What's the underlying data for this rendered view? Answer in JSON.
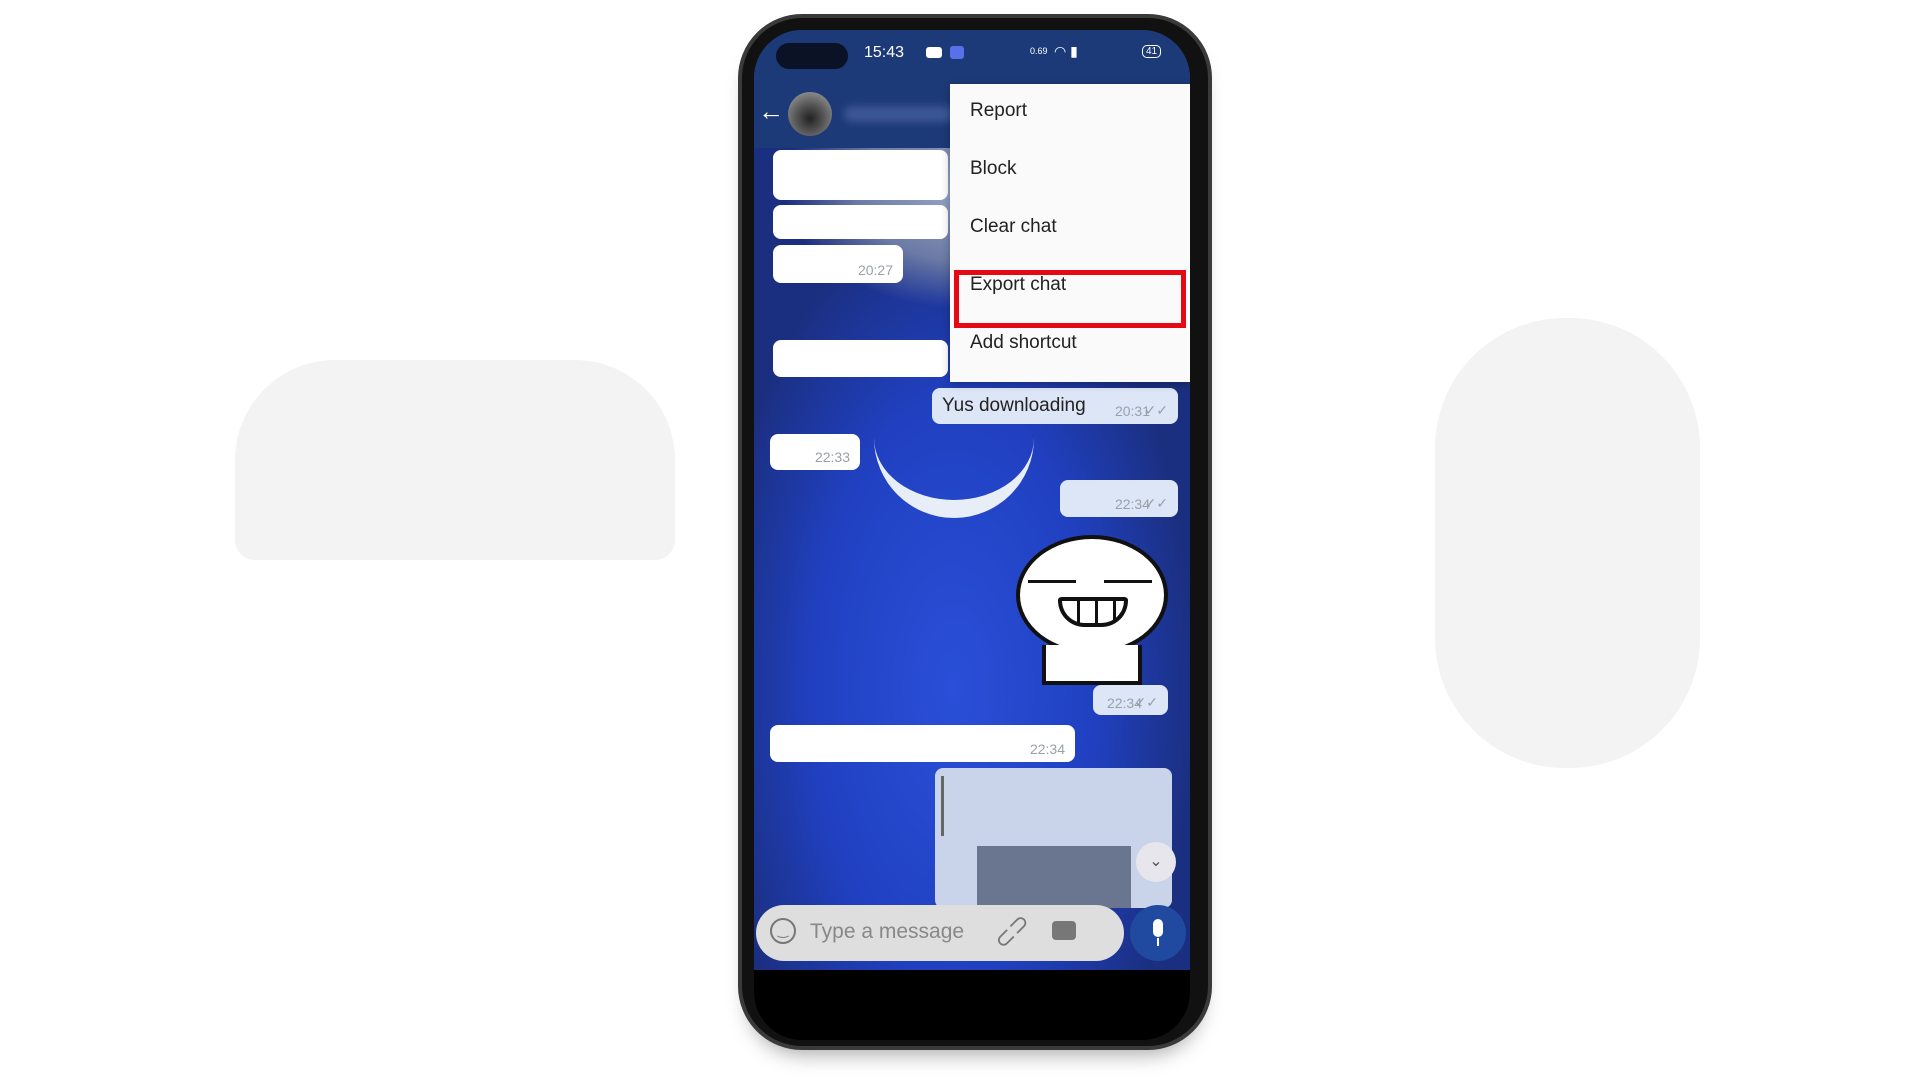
{
  "status_bar": {
    "time": "15:43",
    "network_speed": "0.69",
    "battery": "41"
  },
  "menu": {
    "items": [
      {
        "label": "Report"
      },
      {
        "label": "Block"
      },
      {
        "label": "Clear chat"
      },
      {
        "label": "Export chat",
        "highlighted": true
      },
      {
        "label": "Add shortcut"
      }
    ],
    "highlight_color": "#e50914"
  },
  "messages": [
    {
      "dir": "in",
      "time": ""
    },
    {
      "dir": "in",
      "time": ""
    },
    {
      "dir": "in",
      "time": "20:27"
    },
    {
      "dir": "in",
      "time": ""
    },
    {
      "dir": "out",
      "text": "Yus downloading",
      "time": "20:31",
      "ticks": "✓✓"
    },
    {
      "dir": "in",
      "time": "22:33"
    },
    {
      "dir": "out",
      "time": "22:34",
      "ticks": "✓✓"
    },
    {
      "dir": "out",
      "type": "sticker",
      "time": "22:34",
      "ticks": "✓✓"
    },
    {
      "dir": "in",
      "time": "22:34"
    }
  ],
  "composer": {
    "placeholder": "Type a message"
  },
  "icons": {
    "back": "arrow-left",
    "emoji": "smiley",
    "attach": "paperclip",
    "camera": "camera",
    "mic": "microphone",
    "scroll": "double-chevron-down"
  },
  "colors": {
    "header": "#1d3a78",
    "accent": "#1f4aa0"
  }
}
